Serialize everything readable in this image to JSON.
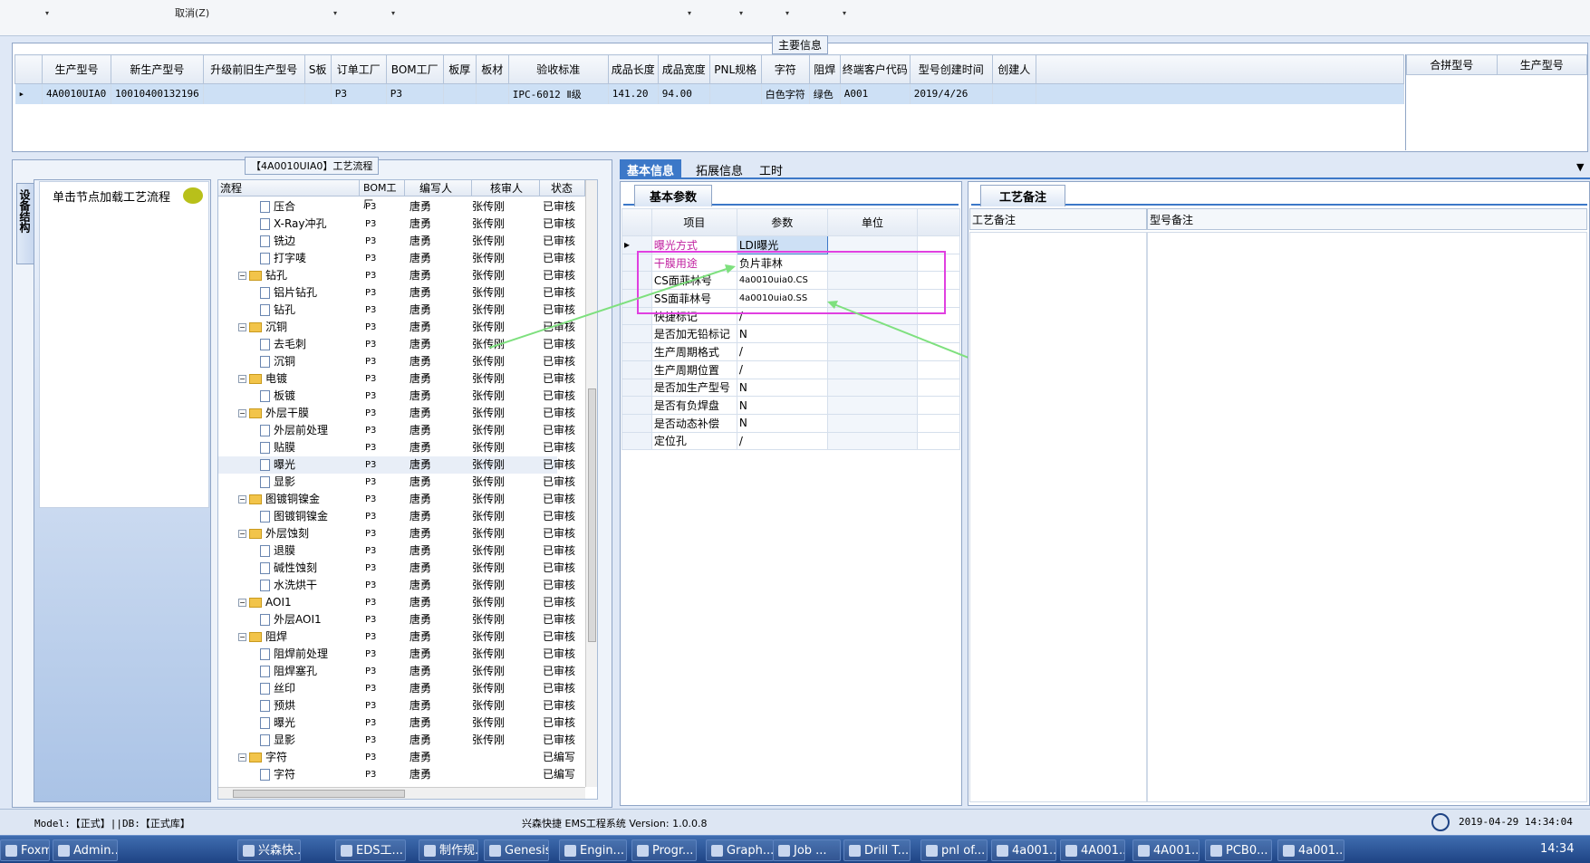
{
  "toolbar": {
    "cancel_label": "取消(Z)"
  },
  "main_info": {
    "title": "主要信息",
    "columns": [
      "生产型号",
      "新生产型号",
      "升级前旧生产型号",
      "S板",
      "订单工厂",
      "BOM工厂",
      "板厚",
      "板材",
      "验收标准",
      "成品长度",
      "成品宽度",
      "PNL规格",
      "字符",
      "阻焊",
      "终端客户代码",
      "型号创建时间",
      "创建人"
    ],
    "row": [
      "4A0010UIA0",
      "10010400132196",
      "",
      "",
      "P3",
      "P3",
      "",
      "",
      "IPC-6012 Ⅱ级",
      "141.20",
      "94.00",
      "",
      "白色字符",
      "绿色",
      "A001",
      "2019/4/26",
      ""
    ],
    "side_columns": [
      "合拼型号",
      "生产型号"
    ]
  },
  "process": {
    "title": "【4A0010UIA0】工艺流程",
    "side_tab": "设备结构",
    "node_hint": "单击节点加载工艺流程",
    "columns": [
      "流程",
      "BOM工厂",
      "编写人",
      "核审人",
      "状态"
    ],
    "rows": [
      {
        "name": "压合",
        "type": "doc",
        "f": "P3",
        "w": "唐勇",
        "r": "张传刚",
        "s": "已审核"
      },
      {
        "name": "X-Ray冲孔",
        "type": "doc",
        "f": "P3",
        "w": "唐勇",
        "r": "张传刚",
        "s": "已审核"
      },
      {
        "name": "铣边",
        "type": "doc",
        "f": "P3",
        "w": "唐勇",
        "r": "张传刚",
        "s": "已审核"
      },
      {
        "name": "打字唛",
        "type": "doc",
        "f": "P3",
        "w": "唐勇",
        "r": "张传刚",
        "s": "已审核"
      },
      {
        "name": "钻孔",
        "type": "folder",
        "f": "P3",
        "w": "唐勇",
        "r": "张传刚",
        "s": "已审核"
      },
      {
        "name": "铝片钻孔",
        "type": "doc",
        "f": "P3",
        "w": "唐勇",
        "r": "张传刚",
        "s": "已审核"
      },
      {
        "name": "钻孔",
        "type": "doc",
        "f": "P3",
        "w": "唐勇",
        "r": "张传刚",
        "s": "已审核"
      },
      {
        "name": "沉铜",
        "type": "folder",
        "f": "P3",
        "w": "唐勇",
        "r": "张传刚",
        "s": "已审核"
      },
      {
        "name": "去毛刺",
        "type": "doc",
        "f": "P3",
        "w": "唐勇",
        "r": "张传刚",
        "s": "已审核"
      },
      {
        "name": "沉铜",
        "type": "doc",
        "f": "P3",
        "w": "唐勇",
        "r": "张传刚",
        "s": "已审核"
      },
      {
        "name": "电镀",
        "type": "folder",
        "f": "P3",
        "w": "唐勇",
        "r": "张传刚",
        "s": "已审核"
      },
      {
        "name": "板镀",
        "type": "doc",
        "f": "P3",
        "w": "唐勇",
        "r": "张传刚",
        "s": "已审核"
      },
      {
        "name": "外层干膜",
        "type": "folder",
        "f": "P3",
        "w": "唐勇",
        "r": "张传刚",
        "s": "已审核"
      },
      {
        "name": "外层前处理",
        "type": "doc",
        "f": "P3",
        "w": "唐勇",
        "r": "张传刚",
        "s": "已审核"
      },
      {
        "name": "贴膜",
        "type": "doc",
        "f": "P3",
        "w": "唐勇",
        "r": "张传刚",
        "s": "已审核"
      },
      {
        "name": "曝光",
        "type": "doc",
        "f": "P3",
        "w": "唐勇",
        "r": "张传刚",
        "s": "已审核"
      },
      {
        "name": "显影",
        "type": "doc",
        "f": "P3",
        "w": "唐勇",
        "r": "张传刚",
        "s": "已审核"
      },
      {
        "name": "图镀铜镍金",
        "type": "folder",
        "f": "P3",
        "w": "唐勇",
        "r": "张传刚",
        "s": "已审核"
      },
      {
        "name": "图镀铜镍金",
        "type": "doc",
        "f": "P3",
        "w": "唐勇",
        "r": "张传刚",
        "s": "已审核"
      },
      {
        "name": "外层蚀刻",
        "type": "folder",
        "f": "P3",
        "w": "唐勇",
        "r": "张传刚",
        "s": "已审核"
      },
      {
        "name": "退膜",
        "type": "doc",
        "f": "P3",
        "w": "唐勇",
        "r": "张传刚",
        "s": "已审核"
      },
      {
        "name": "碱性蚀刻",
        "type": "doc",
        "f": "P3",
        "w": "唐勇",
        "r": "张传刚",
        "s": "已审核"
      },
      {
        "name": "水洗烘干",
        "type": "doc",
        "f": "P3",
        "w": "唐勇",
        "r": "张传刚",
        "s": "已审核"
      },
      {
        "name": "AOI1",
        "type": "folder",
        "f": "P3",
        "w": "唐勇",
        "r": "张传刚",
        "s": "已审核"
      },
      {
        "name": "外层AOI1",
        "type": "doc",
        "f": "P3",
        "w": "唐勇",
        "r": "张传刚",
        "s": "已审核"
      },
      {
        "name": "阻焊",
        "type": "folder",
        "f": "P3",
        "w": "唐勇",
        "r": "张传刚",
        "s": "已审核"
      },
      {
        "name": "阻焊前处理",
        "type": "doc",
        "f": "P3",
        "w": "唐勇",
        "r": "张传刚",
        "s": "已审核"
      },
      {
        "name": "阻焊塞孔",
        "type": "doc",
        "f": "P3",
        "w": "唐勇",
        "r": "张传刚",
        "s": "已审核"
      },
      {
        "name": "丝印",
        "type": "doc",
        "f": "P3",
        "w": "唐勇",
        "r": "张传刚",
        "s": "已审核"
      },
      {
        "name": "预烘",
        "type": "doc",
        "f": "P3",
        "w": "唐勇",
        "r": "张传刚",
        "s": "已审核"
      },
      {
        "name": "曝光",
        "type": "doc",
        "f": "P3",
        "w": "唐勇",
        "r": "张传刚",
        "s": "已审核"
      },
      {
        "name": "显影",
        "type": "doc",
        "f": "P3",
        "w": "唐勇",
        "r": "张传刚",
        "s": "已审核"
      },
      {
        "name": "字符",
        "type": "folder",
        "f": "P3",
        "w": "唐勇",
        "r": "",
        "s": "已编写"
      },
      {
        "name": "字符",
        "type": "doc",
        "f": "P3",
        "w": "唐勇",
        "r": "",
        "s": "已编写"
      }
    ]
  },
  "tabs": [
    "基本信息",
    "拓展信息",
    "工时"
  ],
  "basic": {
    "title": "基本参数",
    "columns": [
      "项目",
      "参数",
      "单位"
    ],
    "rows": [
      {
        "k": "曝光方式",
        "v": "LDI曝光",
        "hl": true
      },
      {
        "k": "干膜用途",
        "v": "负片菲林",
        "hl": true
      },
      {
        "k": "CS面菲林号",
        "v": "4a0010uia0.CS",
        "hl": false
      },
      {
        "k": "SS面菲林号",
        "v": "4a0010uia0.SS",
        "hl": false
      },
      {
        "k": "快捷标记",
        "v": "/",
        "hl": false
      },
      {
        "k": "是否加无铅标记",
        "v": "N",
        "hl": false
      },
      {
        "k": "生产周期格式",
        "v": "/",
        "hl": false
      },
      {
        "k": "生产周期位置",
        "v": "/",
        "hl": false
      },
      {
        "k": "是否加生产型号",
        "v": "N",
        "hl": false
      },
      {
        "k": "是否有负焊盘",
        "v": "N",
        "hl": false
      },
      {
        "k": "是否动态补偿",
        "v": "N",
        "hl": false
      },
      {
        "k": "定位孔",
        "v": "/",
        "hl": false
      }
    ]
  },
  "remarks": {
    "title": "工艺备注",
    "col1": "工艺备注",
    "col2": "型号备注"
  },
  "status": {
    "model": "Model:【正式】||DB:【正式库】",
    "app": "兴森快捷 EMS工程系统 Version: 1.0.0.8",
    "datetime": "2019-04-29 14:34:04"
  },
  "taskbar": {
    "items": [
      "Foxmail",
      "Admin...",
      "兴森快...",
      "EDS工...",
      "制作规...",
      "Genesis",
      "Engin...",
      "Progr...",
      "Graph...",
      "Job ...",
      "Drill T...",
      "pnl of...",
      "4a001...",
      "4A001...",
      "4A001...",
      "PCB0...",
      "4a001..."
    ],
    "clock": "14:34"
  },
  "colors": {
    "accent": "#3c78c8",
    "highlight_box": "#e040e0",
    "arrow": "#7ee07e"
  }
}
